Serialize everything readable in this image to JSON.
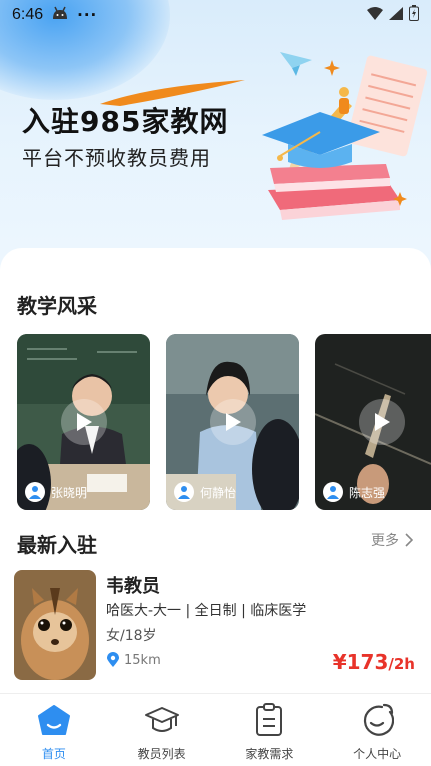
{
  "status_bar": {
    "time": "6:46",
    "dots": "···"
  },
  "hero": {
    "title": "入驻985家教网",
    "subtitle": "平台不预收教员费用"
  },
  "showcase": {
    "title": "教学风采",
    "videos": [
      {
        "teacher": "张晓明"
      },
      {
        "teacher": "何静怡"
      },
      {
        "teacher": "陈志强"
      }
    ]
  },
  "latest": {
    "title": "最新入驻",
    "more_label": "更多",
    "teacher": {
      "name": "韦教员",
      "info": "哈医大-大一 | 全日制 | 临床医学",
      "gender_age": "女/18岁",
      "distance": "15km",
      "price": "¥173",
      "price_unit": "/2h"
    }
  },
  "tabbar": {
    "items": [
      {
        "label": "首页",
        "icon": "home-icon",
        "active": true
      },
      {
        "label": "教员列表",
        "icon": "graduation-cap-icon",
        "active": false
      },
      {
        "label": "家教需求",
        "icon": "clipboard-icon",
        "active": false
      },
      {
        "label": "个人中心",
        "icon": "profile-icon",
        "active": false
      }
    ]
  },
  "colors": {
    "accent": "#2e8ef0",
    "price": "#e8332a",
    "hero_bg": "#e6f3fd"
  }
}
